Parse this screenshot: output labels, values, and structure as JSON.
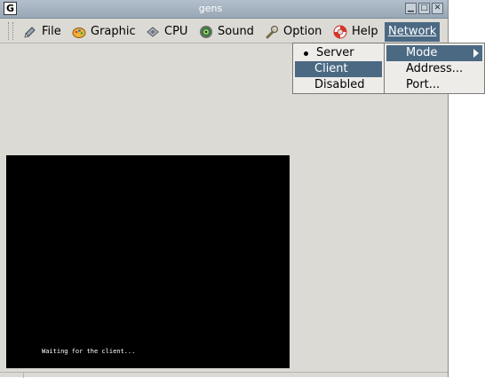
{
  "window": {
    "title": "gens",
    "icon_letter": "G"
  },
  "menubar": {
    "items": [
      {
        "label": "File",
        "icon": "file-icon"
      },
      {
        "label": "Graphic",
        "icon": "graphic-icon"
      },
      {
        "label": "CPU",
        "icon": "cpu-icon"
      },
      {
        "label": "Sound",
        "icon": "sound-icon"
      },
      {
        "label": "Option",
        "icon": "option-icon"
      },
      {
        "label": "Help",
        "icon": "help-icon"
      },
      {
        "label": "Network",
        "icon": ""
      }
    ]
  },
  "mode_menu": {
    "items": [
      {
        "label": "Server",
        "checked": true
      },
      {
        "label": "Client",
        "highlighted": true
      },
      {
        "label": "Disabled"
      }
    ]
  },
  "network_menu": {
    "items": [
      {
        "label": "Mode",
        "has_submenu": true,
        "highlighted": true
      },
      {
        "label": "Address..."
      },
      {
        "label": "Port..."
      }
    ]
  },
  "screen": {
    "message": "Waiting for the client..."
  },
  "colors": {
    "highlight": "#4b6983",
    "window_bg": "#dcdad5",
    "menu_bg": "#eeece9",
    "screen_bg": "#000000"
  }
}
